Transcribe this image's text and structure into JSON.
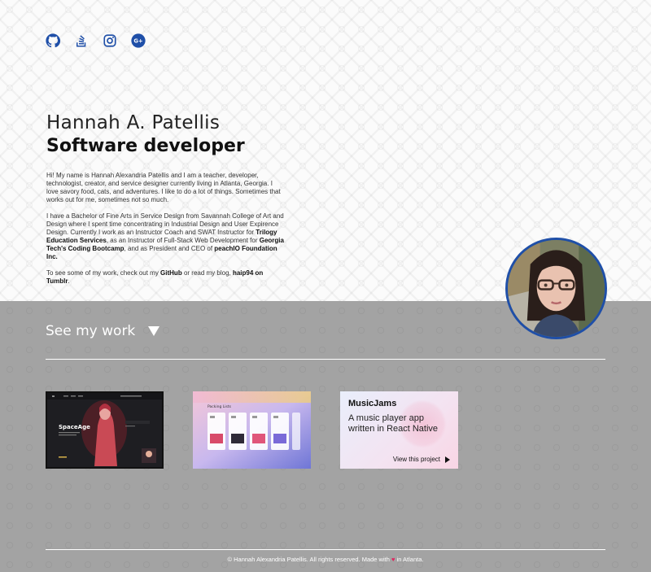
{
  "social": {
    "items": [
      {
        "name": "github",
        "icon": "github-icon"
      },
      {
        "name": "stackoverflow",
        "icon": "stackoverflow-icon"
      },
      {
        "name": "instagram",
        "icon": "instagram-icon"
      },
      {
        "name": "google-plus",
        "icon": "google-plus-icon"
      }
    ],
    "color": "#1f4fa8"
  },
  "hero": {
    "name": "Hannah A. Patellis",
    "role": "Software developer"
  },
  "bio": {
    "p1": "Hi! My name is Hannah Alexandria Patellis and I am a teacher, developer, technologist, creator, and service designer currently living in Atlanta, Georgia. I love savory food, cats, and adventures. I like to do a lot of things. Sometimes that works out for me, sometimes not so much.",
    "p2_a": "I have a Bachelor of Fine Arts in Service Design from Savannah College of Art and Design where I spent time concentrating in Industrial Design and User Expirence Design. Currently I work as an Instructor Coach and SWAT Instructor for ",
    "p2_b": "Trilogy Education Services",
    "p2_c": ", as an Instructor of Full-Stack Web Development for ",
    "p2_d": "Georgia Tech's Coding Bootcamp",
    "p2_e": ", and as President and CEO of ",
    "p2_f": "peachIO Foundation Inc.",
    "p3_a": "To see some of my work, check out my ",
    "p3_b": "GitHub",
    "p3_c": " or read my blog, ",
    "p3_d": "haip94 on Tumblr",
    "p3_e": "."
  },
  "work": {
    "heading": "See my work",
    "projects": [
      {
        "name": "SpaceAge",
        "label": "SpaceAge"
      },
      {
        "name": "Packing List",
        "label": "Packing Lists"
      },
      {
        "name": "MusicJams",
        "title": "MusicJams",
        "description": "A music player app written in React Native",
        "link": "View this project"
      }
    ]
  },
  "footer": {
    "text_a": "© Hannah Alexandria Patellis. All rights reserved. Made with ",
    "text_b": " in Atlanta.",
    "heart": "♥"
  },
  "colors": {
    "accent": "#1f4fa8",
    "work_bg": "#a3a3a3",
    "heart": "#e0245e"
  }
}
